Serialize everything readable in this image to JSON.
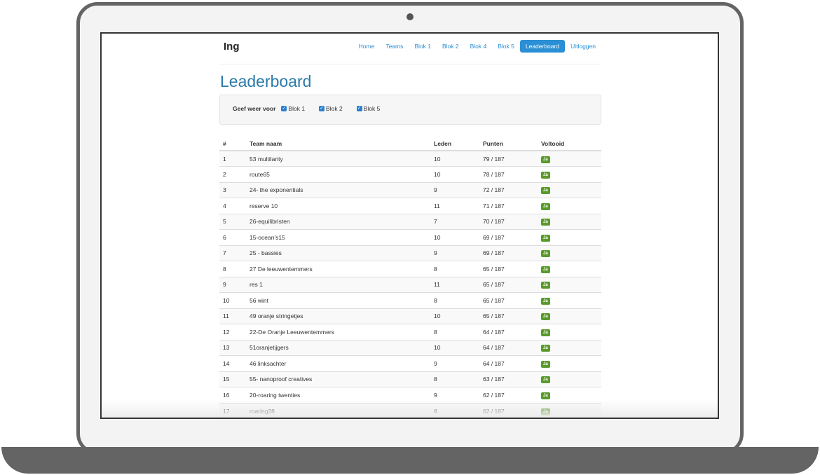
{
  "brand": "Ing",
  "nav": [
    {
      "label": "Home",
      "active": false
    },
    {
      "label": "Teams",
      "active": false
    },
    {
      "label": "Blok 1",
      "active": false
    },
    {
      "label": "Blok 2",
      "active": false
    },
    {
      "label": "Blok 4",
      "active": false
    },
    {
      "label": "Blok 5",
      "active": false
    },
    {
      "label": "Leaderboard",
      "active": true
    },
    {
      "label": "Uitloggen",
      "active": false
    }
  ],
  "page_title": "Leaderboard",
  "filter": {
    "label": "Geef weer voor",
    "options": [
      {
        "label": "Blok 1",
        "checked": true
      },
      {
        "label": "Blok 2",
        "checked": true
      },
      {
        "label": "Blok 5",
        "checked": true
      }
    ]
  },
  "table": {
    "headers": [
      "#",
      "Team naam",
      "Leden",
      "Punten",
      "Voltooid"
    ],
    "rows": [
      {
        "rank": "1",
        "team": "53 multilarity",
        "leden": "10",
        "punten": "79 / 187",
        "voltooid": "Ja"
      },
      {
        "rank": "2",
        "team": "route65",
        "leden": "10",
        "punten": "78 / 187",
        "voltooid": "Ja"
      },
      {
        "rank": "3",
        "team": "24- the exponentials",
        "leden": "9",
        "punten": "72 / 187",
        "voltooid": "Ja"
      },
      {
        "rank": "4",
        "team": "reserve 10",
        "leden": "11",
        "punten": "71 / 187",
        "voltooid": "Ja"
      },
      {
        "rank": "5",
        "team": "26-equilibristen",
        "leden": "7",
        "punten": "70 / 187",
        "voltooid": "Ja"
      },
      {
        "rank": "6",
        "team": "15-ocean's15",
        "leden": "10",
        "punten": "69 / 187",
        "voltooid": "Ja"
      },
      {
        "rank": "7",
        "team": "25 - bassies",
        "leden": "9",
        "punten": "69 / 187",
        "voltooid": "Ja"
      },
      {
        "rank": "8",
        "team": "27 De leeuwentemmers",
        "leden": "8",
        "punten": "65 / 187",
        "voltooid": "Ja"
      },
      {
        "rank": "9",
        "team": "res 1",
        "leden": "11",
        "punten": "65 / 187",
        "voltooid": "Ja"
      },
      {
        "rank": "10",
        "team": "56 wint",
        "leden": "8",
        "punten": "65 / 187",
        "voltooid": "Ja"
      },
      {
        "rank": "11",
        "team": "49 oranje stringetjes",
        "leden": "10",
        "punten": "65 / 187",
        "voltooid": "Ja"
      },
      {
        "rank": "12",
        "team": "22-De Oranje Leeuwentemmers",
        "leden": "8",
        "punten": "64 / 187",
        "voltooid": "Ja"
      },
      {
        "rank": "13",
        "team": "51oranjetijgers",
        "leden": "10",
        "punten": "64 / 187",
        "voltooid": "Ja"
      },
      {
        "rank": "14",
        "team": "46 linksachter",
        "leden": "9",
        "punten": "64 / 187",
        "voltooid": "Ja"
      },
      {
        "rank": "15",
        "team": "55- nanoproof creatives",
        "leden": "8",
        "punten": "63 / 187",
        "voltooid": "Ja"
      },
      {
        "rank": "16",
        "team": "20-roaring twenties",
        "leden": "9",
        "punten": "62 / 187",
        "voltooid": "Ja"
      },
      {
        "rank": "17",
        "team": "roaring28",
        "leden": "8",
        "punten": "62 / 187",
        "voltooid": "Ja"
      }
    ]
  },
  "colors": {
    "link": "#2a8fd4",
    "title": "#2a7aaa",
    "badge": "#5a9a2c",
    "frame": "#646464"
  }
}
